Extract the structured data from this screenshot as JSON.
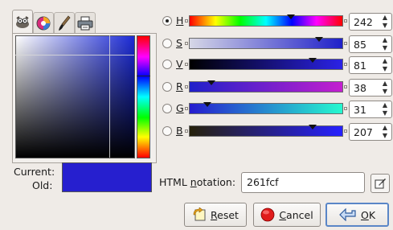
{
  "selector_tabs": [
    {
      "name": "gimp",
      "icon": "wilber-icon",
      "active": true
    },
    {
      "name": "wheel",
      "icon": "color-wheel-icon",
      "active": false
    },
    {
      "name": "watercolor",
      "icon": "paintbrush-icon",
      "active": false
    },
    {
      "name": "printer",
      "icon": "printer-icon",
      "active": false
    }
  ],
  "channels": [
    {
      "key": "H",
      "label": "H",
      "value": "242",
      "selected": true,
      "fraction": 0.67
    },
    {
      "key": "S",
      "label": "S",
      "value": "85",
      "selected": false,
      "fraction": 0.85
    },
    {
      "key": "V",
      "label": "V",
      "value": "81",
      "selected": false,
      "fraction": 0.81
    },
    {
      "key": "R",
      "label": "R",
      "value": "38",
      "selected": false,
      "fraction": 0.149
    },
    {
      "key": "G",
      "label": "G",
      "value": "31",
      "selected": false,
      "fraction": 0.122
    },
    {
      "key": "B",
      "label": "B",
      "value": "207",
      "selected": false,
      "fraction": 0.812
    }
  ],
  "current_label": "Current:",
  "old_label": "Old:",
  "current_color": "#261fcf",
  "html_notation": {
    "label_prefix": "HTML ",
    "label_mnemonic": "n",
    "label_suffix": "otation:",
    "value": "261fcf"
  },
  "buttons": {
    "reset": {
      "mnemonic": "R",
      "rest": "eset"
    },
    "cancel": {
      "mnemonic": "C",
      "rest": "ancel"
    },
    "ok": {
      "mnemonic": "O",
      "rest": "K"
    }
  },
  "colors": {
    "background": "#efebe7",
    "default_border": "#5a86c7"
  }
}
